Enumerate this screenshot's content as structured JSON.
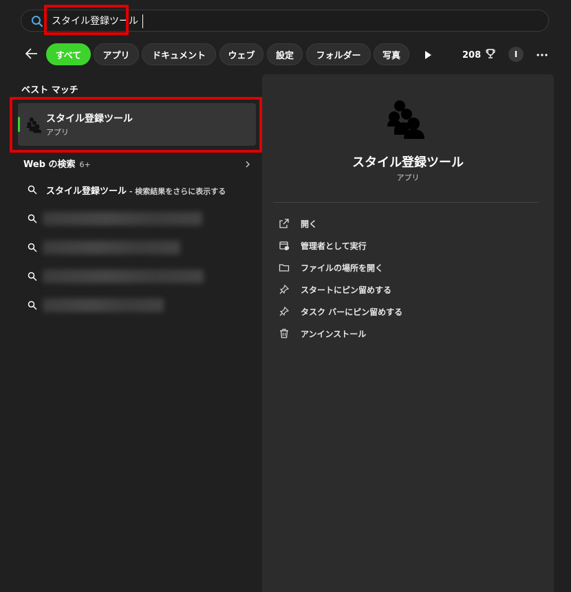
{
  "search": {
    "value": "スタイル登録ツール",
    "placeholder": ""
  },
  "filters": [
    {
      "label": "すべて",
      "active": true
    },
    {
      "label": "アプリ"
    },
    {
      "label": "ドキュメント"
    },
    {
      "label": "ウェブ"
    },
    {
      "label": "設定"
    },
    {
      "label": "フォルダー"
    },
    {
      "label": "写真"
    }
  ],
  "toolbar": {
    "points": "208",
    "user_initial": "I"
  },
  "best_match": {
    "section_title": "ベスト マッチ",
    "name": "スタイル登録ツール",
    "type": "アプリ"
  },
  "web": {
    "title": "Web の検索",
    "count": "6+",
    "first_query": "スタイル登録ツール",
    "first_suffix": " - 検索結果をさらに表示する"
  },
  "detail": {
    "title": "スタイル登録ツール",
    "subtitle": "アプリ",
    "actions": [
      {
        "label": "開く",
        "icon": "open-external-icon"
      },
      {
        "label": "管理者として実行",
        "icon": "run-as-admin-icon"
      },
      {
        "label": "ファイルの場所を開く",
        "icon": "folder-icon"
      },
      {
        "label": "スタートにピン留めする",
        "icon": "pin-icon"
      },
      {
        "label": "タスク バーにピン留めする",
        "icon": "pin-icon"
      },
      {
        "label": "アンインストール",
        "icon": "trash-icon"
      }
    ]
  },
  "colors": {
    "background": "#202020",
    "panel": "#2c2c2c",
    "accent": "#3ed32c",
    "highlight": "#e00000"
  }
}
